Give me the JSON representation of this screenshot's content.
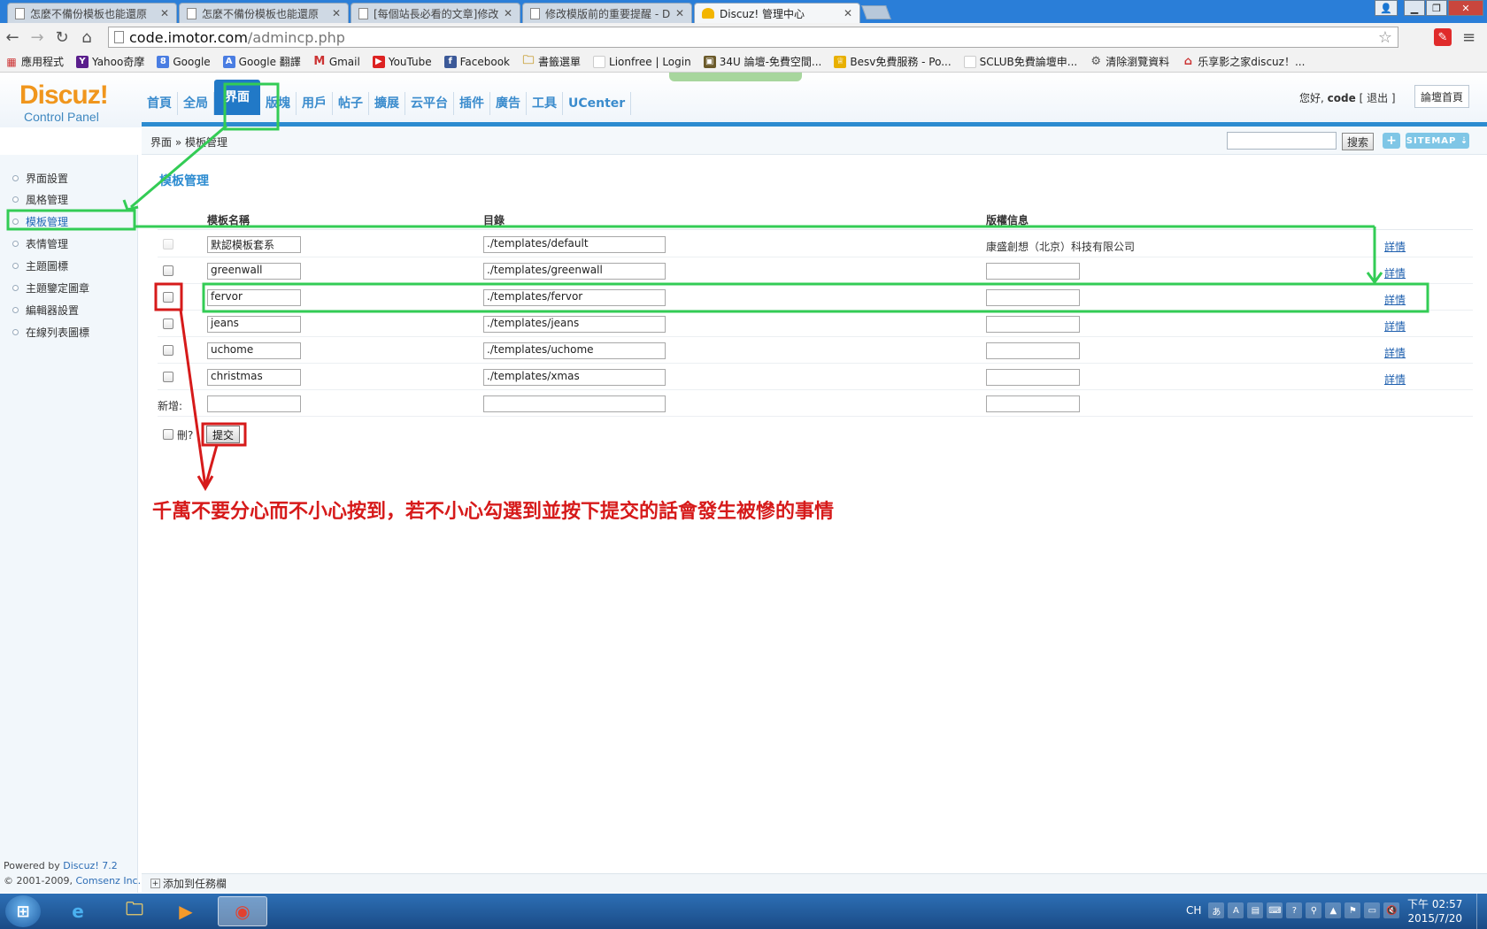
{
  "browser": {
    "tabs": [
      {
        "title": "怎麼不備份模板也能還原"
      },
      {
        "title": "怎麼不備份模板也能還原"
      },
      {
        "title": "[每個站長必看的文章]修改"
      },
      {
        "title": "修改模版前的重要提醒 - D"
      },
      {
        "title": "Discuz! 管理中心"
      }
    ],
    "url_host": "code.imotor.com",
    "url_path": "/admincp.php",
    "bookmarks": [
      {
        "label": "應用程式"
      },
      {
        "label": "Yahoo奇摩"
      },
      {
        "label": "Google"
      },
      {
        "label": "Google 翻譯"
      },
      {
        "label": "Gmail"
      },
      {
        "label": "YouTube"
      },
      {
        "label": "Facebook"
      },
      {
        "label": "書籤選單"
      },
      {
        "label": "Lionfree | Login"
      },
      {
        "label": "34U 論壇-免費空間..."
      },
      {
        "label": "Besv免費服務 - Po..."
      },
      {
        "label": "SCLUB免費論壇申..."
      },
      {
        "label": "清除瀏覽資料"
      },
      {
        "label": "乐享影之家discuz！..."
      }
    ]
  },
  "header": {
    "logo": "Discuz!",
    "logo_sub": "Control Panel",
    "nav": [
      "首頁",
      "全局",
      "界面",
      "版塊",
      "用戶",
      "帖子",
      "擴展",
      "云平台",
      "插件",
      "廣告",
      "工具",
      "UCenter"
    ],
    "greeting": "您好,",
    "username": "code",
    "logout": "[ 退出 ]",
    "forum_home": "論壇首頁"
  },
  "subbar": {
    "breadcrumb": "界面 » 模板管理",
    "search_button": "搜索",
    "plus": "+",
    "sitemap": "SITEMAP ⇣"
  },
  "sidebar": {
    "items": [
      "界面設置",
      "風格管理",
      "模板管理",
      "表情管理",
      "主題圖標",
      "主題鑒定圖章",
      "編輯器設置",
      "在線列表圖標"
    ],
    "powered_prefix": "Powered by",
    "powered_link": "Discuz! 7.2",
    "copyright_prefix": "© 2001-2009,",
    "copyright_link": "Comsenz Inc."
  },
  "main": {
    "title": "模板管理",
    "headers": {
      "name": "模板名稱",
      "dir": "目錄",
      "copyright": "版權信息"
    },
    "templates": [
      {
        "name": "默認模板套系",
        "dir": "./templates/default",
        "copyright": "康盛創想（北京）科技有限公司",
        "detail": "詳情"
      },
      {
        "name": "greenwall",
        "dir": "./templates/greenwall",
        "copyright": "",
        "detail": "詳情"
      },
      {
        "name": "fervor",
        "dir": "./templates/fervor",
        "copyright": "",
        "detail": "詳情"
      },
      {
        "name": "jeans",
        "dir": "./templates/jeans",
        "copyright": "",
        "detail": "詳情"
      },
      {
        "name": "uchome",
        "dir": "./templates/uchome",
        "copyright": "",
        "detail": "詳情"
      },
      {
        "name": "christmas",
        "dir": "./templates/xmas",
        "copyright": "",
        "detail": "詳情"
      }
    ],
    "new_label": "新增:",
    "delete_label": "刪?",
    "submit": "提交"
  },
  "annotation": {
    "text": "千萬不要分心而不小心按到，若不小心勾選到並按下提交的話會發生被慘的事情",
    "green": "#33cc55",
    "red": "#d61a1a"
  },
  "footer": {
    "add_to_taskbar": "添加到任務欄"
  },
  "taskbar": {
    "tray_lang": "CH",
    "time": "下午 02:57",
    "date": "2015/7/20"
  }
}
